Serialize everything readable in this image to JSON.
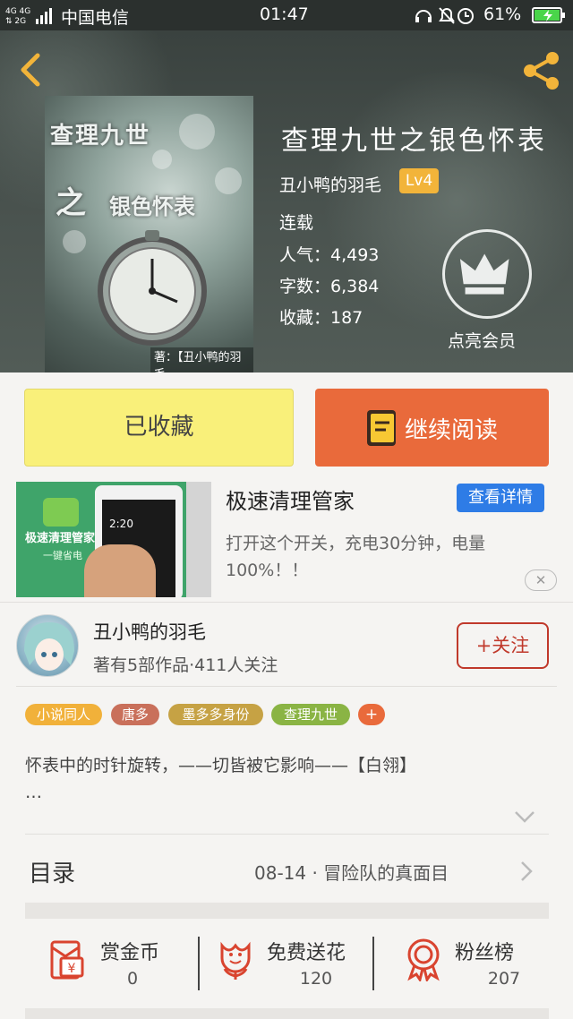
{
  "status_bar": {
    "carrier": "中国电信",
    "time": "01:47",
    "battery": "61%"
  },
  "book": {
    "title": "查理九世之银色怀表",
    "author": "丑小鸭的羽毛",
    "level": "Lv4",
    "status": "连载",
    "popularity": "人气：4,493",
    "word_count": "字数：6,384",
    "favorites": "收藏：187",
    "vip_label": "点亮会员",
    "cover": {
      "title_line1": "查理九世",
      "title_line2": "之",
      "title_line3": "银色怀表",
      "author_tag": "著：【丑小鸭的羽毛"
    }
  },
  "actions": {
    "collected": "已收藏",
    "continue_reading": "继续阅读"
  },
  "ad": {
    "image_title": "极速清理管家",
    "image_subtitle": "一键省电",
    "image_time": "2:20",
    "title": "极速清理管家",
    "detail_button": "查看详情",
    "description": "打开这个开关，充电30分钟，电量100%！！",
    "close": "✕"
  },
  "author_row": {
    "name": "丑小鸭的羽毛",
    "meta": "著有5部作品·411人关注",
    "follow": "+关注"
  },
  "tags": [
    "小说同人",
    "唐多",
    "墨多多身份",
    "查理九世",
    "+"
  ],
  "summary": "怀表中的时针旋转，——切皆被它影响——【白翎】\n…",
  "catalog": {
    "label": "目录",
    "latest": "08-14 · 冒险队的真面目"
  },
  "bottom": [
    {
      "label": "赏金币",
      "value": "0",
      "icon": "red-envelope-icon"
    },
    {
      "label": "免费送花",
      "value": "120",
      "icon": "flower-icon"
    },
    {
      "label": "粉丝榜",
      "value": "207",
      "icon": "medal-icon"
    }
  ],
  "colors": {
    "accent_orange": "#e96a3b",
    "collect_yellow": "#f9f07a",
    "follow_red": "#c0392b",
    "ad_blue": "#2e7ce6"
  }
}
